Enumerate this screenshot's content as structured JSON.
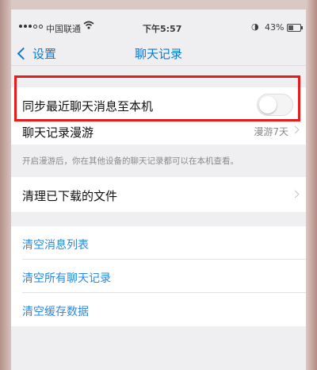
{
  "status_bar": {
    "carrier": "中国联通",
    "time": "下午5:57",
    "battery_text": "43%",
    "battery_level": 0.43
  },
  "nav": {
    "back_label": "设置",
    "title": "聊天记录"
  },
  "settings": {
    "sync_recent_label": "同步最近聊天消息至本机",
    "sync_recent_on": false,
    "roaming_label": "聊天记录漫游",
    "roaming_value": "漫游7天",
    "roaming_note": "开启漫游后，你在其他设备的聊天记录都可以在本机查看。",
    "clear_downloads_label": "清理已下载的文件",
    "clear_message_list_label": "清空消息列表",
    "clear_all_chats_label": "清空所有聊天记录",
    "clear_cache_label": "清空缓存数据"
  },
  "colors": {
    "accent": "#0a7ad8",
    "highlight": "#e61c1c",
    "action_text": "#2a8ae0"
  }
}
